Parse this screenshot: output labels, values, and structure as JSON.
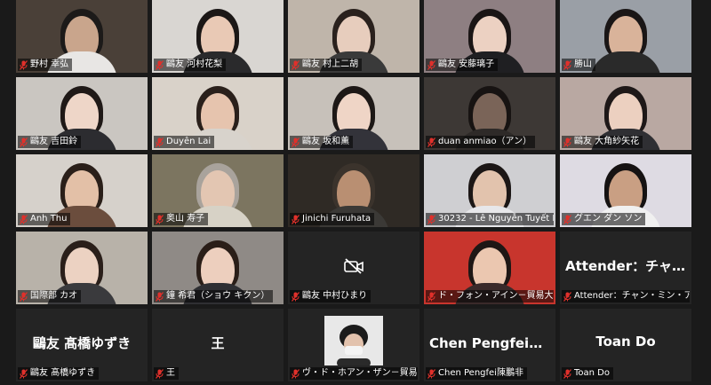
{
  "tiles": [
    {
      "name": "野村 幸弘",
      "kind": "video",
      "bg": "#4a4038",
      "skin": "#c9a58c",
      "hair": "#1c1a19",
      "shirt": "#e8e6e4"
    },
    {
      "name": "鷗友  河村花梨",
      "kind": "video",
      "bg": "#d9d6d2",
      "skin": "#e9c9b5",
      "hair": "#1b1716",
      "shirt": "#2a2a2c"
    },
    {
      "name": "鷗友  村上二胡",
      "kind": "video",
      "bg": "#bfb5aa",
      "skin": "#e7cdbd",
      "hair": "#2a211d",
      "shirt": "#3a3a3a"
    },
    {
      "name": "鷗友 安藤璃子",
      "kind": "video",
      "bg": "#8e7f82",
      "skin": "#ecd1c2",
      "hair": "#1a1515",
      "shirt": "#1f1f22"
    },
    {
      "name": "勝山",
      "kind": "video",
      "bg": "#9a9fa6",
      "skin": "#d9b39a",
      "hair": "#1a1616",
      "shirt": "#2a2a2a"
    },
    {
      "name": "鷗友  吉田鈴",
      "kind": "video",
      "bg": "#cac6c1",
      "skin": "#eed6c8",
      "hair": "#1f1917",
      "shirt": "#2c2c30"
    },
    {
      "name": "Duyên Lai",
      "kind": "video",
      "bg": "#d9d2c9",
      "skin": "#e6c4ae",
      "hair": "#2a201b",
      "shirt": "#d8d3cc"
    },
    {
      "name": "鷗友  坂和薫",
      "kind": "video",
      "bg": "#c7c1ba",
      "skin": "#efd5c6",
      "hair": "#1d1816",
      "shirt": "#33333a"
    },
    {
      "name": "duan anmiao（アン）",
      "kind": "video",
      "bg": "#3d3835",
      "skin": "#7a6458",
      "hair": "#171312",
      "shirt": "#2e2a28"
    },
    {
      "name": "鷗友  大角紗矢花",
      "kind": "video",
      "bg": "#b9a8a2",
      "skin": "#ecd0c0",
      "hair": "#1e1818",
      "shirt": "#2f2f33"
    },
    {
      "name": "Anh Thu",
      "kind": "video",
      "bg": "#d6d1cb",
      "skin": "#e3c0a7",
      "hair": "#2a1f19",
      "shirt": "#6b4d3d"
    },
    {
      "name": "奥山 寿子",
      "kind": "video",
      "bg": "#7c7560",
      "skin": "#e3c6b2",
      "hair": "#a9a39c",
      "shirt": "#d7d2c6"
    },
    {
      "name": "Jinichi Furuhata",
      "kind": "video",
      "bg": "#2f2a25",
      "skin": "#b98f72",
      "hair": "#3b332c",
      "shirt": "#3b3936"
    },
    {
      "name": "30232 - Lê Nguyễn Tuyết Nhi",
      "kind": "video",
      "bg": "#cfcfd2",
      "skin": "#e2c3ad",
      "hair": "#1c1716",
      "shirt": "#e7e7ea"
    },
    {
      "name": "グエン  ダン  ソン",
      "kind": "video",
      "bg": "#dedbe3",
      "skin": "#c99f83",
      "hair": "#151212",
      "shirt": "#f0f0f0"
    },
    {
      "name": "国際部 カオ",
      "kind": "video",
      "bg": "#b8b2a9",
      "skin": "#ecd2c2",
      "hair": "#2a1f1a",
      "shirt": "#3a3a3d"
    },
    {
      "name": "鐘  希君（ショウ  キクン）",
      "kind": "video",
      "bg": "#8f8a86",
      "skin": "#edcfbe",
      "hair": "#2a1e18",
      "shirt": "#2f2f33"
    },
    {
      "name": "鷗友  中村ひまり",
      "kind": "camoff"
    },
    {
      "name": "ド・フォン・アイン－貿易大学",
      "kind": "video",
      "bg": "#c8352d",
      "skin": "#ebc7b0",
      "hair": "#1e1715",
      "shirt": "#3a2a2a"
    },
    {
      "name": "Attender：チャン・ミン・アイン",
      "kind": "text",
      "center": "Attender：チャ..."
    },
    {
      "name": "鷗友  髙橋ゆずき",
      "kind": "text",
      "center": "鷗友  髙橋ゆずき"
    },
    {
      "name": "王",
      "kind": "text",
      "center": "王"
    },
    {
      "name": "ヴ・ド・ホアン・ザン－貿易大学",
      "kind": "photo"
    },
    {
      "name": "Chen Pengfei陳鵬非",
      "kind": "text",
      "center": "Chen  Pengfei陳..."
    },
    {
      "name": "Toan Do",
      "kind": "text",
      "center": "Toan Do"
    }
  ],
  "colors": {
    "mic_muted": "#e0302b",
    "label_text": "#ffffff",
    "window_bg": "#1a1a1a"
  },
  "icons": {
    "muted_mic": "mic-muted-icon",
    "camera_off": "camera-off-icon"
  }
}
